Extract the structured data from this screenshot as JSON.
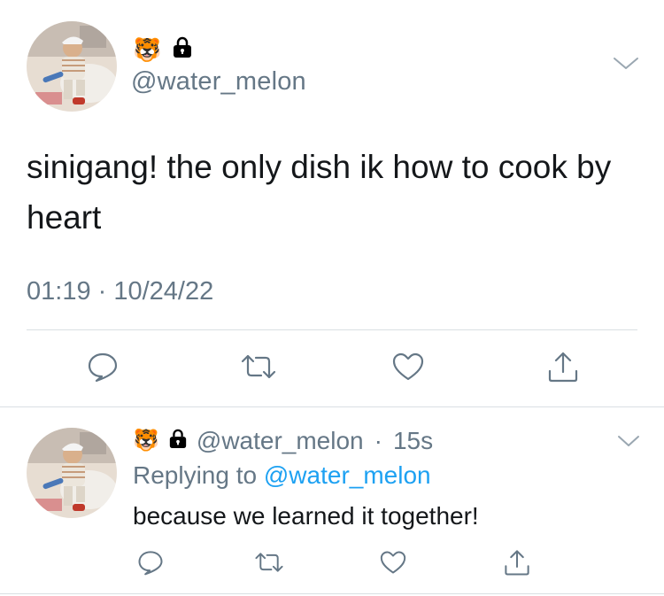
{
  "main_tweet": {
    "emoji_1": "🐯",
    "emoji_2_icon": "lock-icon",
    "handle": "@water_melon",
    "text": "sinigang! the only dish ik how to cook by heart",
    "timestamp": "01:19 · 10/24/22",
    "actions": [
      "reply-icon",
      "retweet-icon",
      "like-icon",
      "share-icon"
    ]
  },
  "reply_tweet": {
    "emoji_1": "🐯",
    "emoji_2_icon": "lock-icon",
    "handle": "@water_melon",
    "separator": "·",
    "time_ago": "15s",
    "replying_prefix": "Replying to",
    "replying_to": "@water_melon",
    "text": "because we learned it together!",
    "actions": [
      "reply-icon",
      "retweet-icon",
      "like-icon",
      "share-icon"
    ]
  },
  "colors": {
    "text": "#14171a",
    "secondary": "#657786",
    "link": "#1da1f2",
    "divider": "#d9dfe3"
  }
}
